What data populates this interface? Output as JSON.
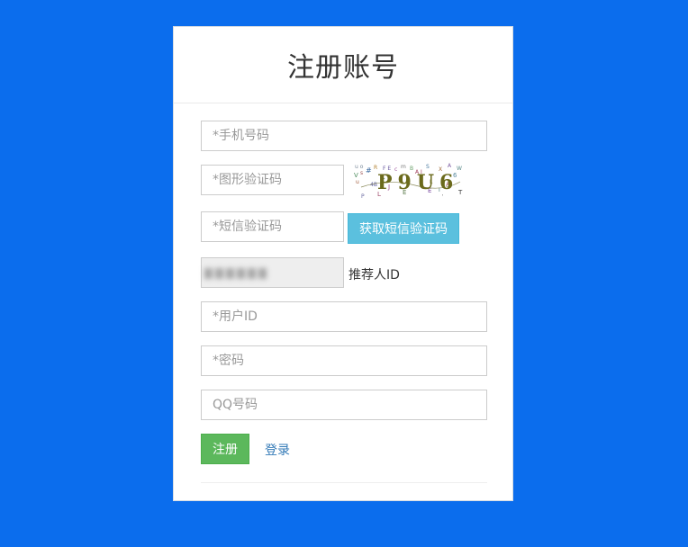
{
  "page": {
    "background_color": "#0b6ded"
  },
  "form": {
    "title": "注册账号",
    "phone_placeholder": "*手机号码",
    "captcha_placeholder": "*图形验证码",
    "captcha_text": "P9U6",
    "sms_code_placeholder": "*短信验证码",
    "sms_button_label": "获取短信验证码",
    "referrer_label": "推荐人ID",
    "user_id_placeholder": "*用户ID",
    "password_placeholder": "*密码",
    "qq_placeholder": "QQ号码",
    "submit_label": "注册",
    "login_label": "登录"
  },
  "colors": {
    "submit_button": "#5cb85c",
    "sms_button": "#5bc0de",
    "link": "#337ab7"
  }
}
